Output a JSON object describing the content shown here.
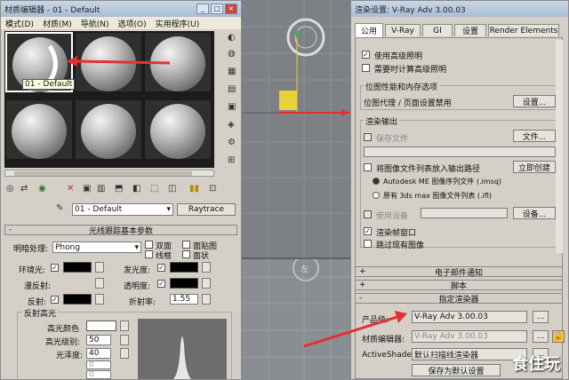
{
  "material_editor": {
    "title": "材质编辑器 - 01 - Default",
    "menu": [
      "模式(D)",
      "材质(M)",
      "导航(N)",
      "选项(O)",
      "实用程序(U)"
    ],
    "tooltip": "01 - Default",
    "material_name": "01 - Default",
    "raytrace_button": "Raytrace",
    "rollout_basic": "光线跟踪基本参数",
    "shading_label": "明暗处理:",
    "shading_value": "Phong",
    "opt_two_sided": "双面",
    "opt_wire": "线框",
    "opt_face_map": "面贴图",
    "opt_faceted": "面状",
    "ambient_label": "环境光:",
    "diffuse_label": "漫反射:",
    "reflect_label": "反射:",
    "luminosity_label": "发光度:",
    "transparency_label": "透明度:",
    "ior_label": "折射率:",
    "ior_value": "1.55",
    "specular_group": "反射高光",
    "spec_color_label": "高光颜色",
    "spec_level_label": "高光级别:",
    "spec_level_value": "50",
    "glossiness_label": "光泽度:",
    "glossiness_value": "40",
    "field_n1": "0",
    "field_n2": "0"
  },
  "render_setup": {
    "title": "渲染设置: V-Ray Adv 3.00.03",
    "tabs": [
      "公用",
      "V-Ray",
      "GI",
      "设置",
      "Render Elements"
    ],
    "use_advanced_lighting": "使用高级照明",
    "compute_advanced_lighting": "需要时计算高级照明",
    "bitmap_group": "位图性能和内存选项",
    "bitmap_text": "位图代理 / 页面设置禁用",
    "bitmap_settings_btn": "设置...",
    "render_output_group": "渲染输出",
    "save_file": "保存文件",
    "files_btn": "文件...",
    "put_image_file_list": "将图像文件列表放入输出路径",
    "create_now_btn": "立即创建",
    "autodesk_me_option": "Autodesk ME 图像序列文件 (.imsq)",
    "legacy_option": "原有 3ds max 图像文件列表 (.ifl)",
    "use_device": "使用设备",
    "device_btn": "设备...",
    "rendered_frame_window": "渲染帧窗口",
    "skip_existing": "跳过现有图像",
    "rollout_email": "电子邮件通知",
    "rollout_script": "脚本",
    "rollout_assign": "指定渲染器",
    "production_label": "产品级:",
    "production_value": "V-Ray Adv 3.00.03",
    "mat_editor_label": "材质编辑器:",
    "mat_editor_value": "V-Ray Adv 3.00.03",
    "activeshade_label": "ActiveShade:",
    "activeshade_value": "默认扫描线渲染器",
    "save_default_btn": "保存为默认设置",
    "ellipsis": "...",
    "sign_plus": "+",
    "sign_minus": "-"
  },
  "viewport": {
    "label": "左"
  },
  "watermark": "食住玩",
  "colors": {
    "arrow_red": "#e53030",
    "gizmo_yellow": "#e8d23a",
    "viewport_grey": "#7d8084"
  }
}
